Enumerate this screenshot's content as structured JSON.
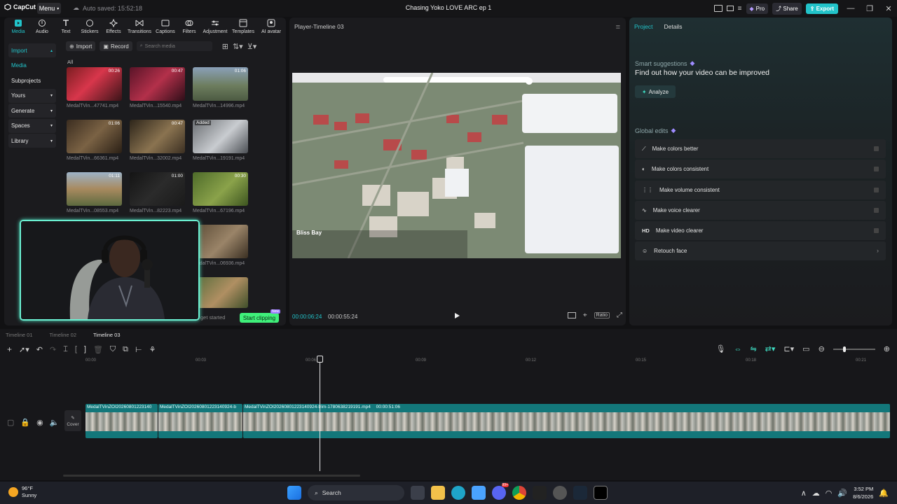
{
  "titlebar": {
    "logo": "CapCut",
    "menu_label": "Menu",
    "autosave": "Auto saved: 15:52:18",
    "project_title": "Chasing Yoko LOVE ARC ep 1",
    "pro_label": "Pro",
    "share_label": "Share",
    "export_label": "Export"
  },
  "toolbar": {
    "tools": [
      {
        "label": "Media",
        "icon": "media-icon"
      },
      {
        "label": "Audio",
        "icon": "audio-icon"
      },
      {
        "label": "Text",
        "icon": "text-icon"
      },
      {
        "label": "Stickers",
        "icon": "stickers-icon"
      },
      {
        "label": "Effects",
        "icon": "effects-icon"
      },
      {
        "label": "Transitions",
        "icon": "transitions-icon"
      },
      {
        "label": "Captions",
        "icon": "captions-icon"
      },
      {
        "label": "Filters",
        "icon": "filters-icon"
      },
      {
        "label": "Adjustment",
        "icon": "adjustment-icon"
      },
      {
        "label": "Templates",
        "icon": "templates-icon"
      },
      {
        "label": "AI avatar",
        "icon": "ai-avatar-icon"
      }
    ]
  },
  "sidebar": {
    "items": [
      {
        "label": "Import"
      },
      {
        "label": "Media"
      },
      {
        "label": "Subprojects"
      },
      {
        "label": "Yours"
      },
      {
        "label": "Generate"
      },
      {
        "label": "Spaces"
      },
      {
        "label": "Library"
      }
    ]
  },
  "media": {
    "import_label": "Import",
    "record_label": "Record",
    "search_placeholder": "Search media",
    "all_label": "All",
    "thumbs": [
      {
        "name": "MedalTVin...47741.mp4",
        "duration": "00:26"
      },
      {
        "name": "MedalTVin...15540.mp4",
        "duration": "00:47"
      },
      {
        "name": "MedalTVin...14996.mp4",
        "duration": "01:06"
      },
      {
        "name": "MedalTVin...66361.mp4",
        "duration": "01:06"
      },
      {
        "name": "MedalTVin...32002.mp4",
        "duration": "00:47"
      },
      {
        "name": "MedalTVin...19191.mp4",
        "duration": "",
        "badge": "Added"
      },
      {
        "name": "MedalTVin...08553.mp4",
        "duration": "01:11"
      },
      {
        "name": "MedalTVin...82223.mp4",
        "duration": "01:00"
      },
      {
        "name": "MedalTVin...67196.mp4",
        "duration": "00:30"
      },
      {
        "name": "MedalTVin...06936.mp4",
        "duration": ""
      },
      {
        "name": "",
        "duration": ""
      }
    ],
    "get_started": "get started",
    "start_clipping": "Start clipping",
    "new_badge": "New"
  },
  "player": {
    "title": "Player-Timeline 03",
    "current_time": "00:00:06:24",
    "total_time": "00:00:55:24",
    "ratio_label": "Ratio",
    "preview_caption": "Bliss Bay"
  },
  "right_panel": {
    "tabs": [
      "Project",
      "Details"
    ],
    "smart_title": "Smart suggestions",
    "smart_sub": "Find out how your video can be improved",
    "analyze_label": "Analyze",
    "global_edits_title": "Global edits",
    "global_edits": [
      {
        "label": "Make colors better",
        "icon": "wand-icon"
      },
      {
        "label": "Make colors consistent",
        "icon": "palette-icon"
      },
      {
        "label": "Make volume consistent",
        "icon": "volume-bars-icon"
      },
      {
        "label": "Make voice clearer",
        "icon": "voice-icon"
      },
      {
        "label": "Make video clearer",
        "icon": "hd-icon",
        "icon_text": "HD"
      },
      {
        "label": "Retouch face",
        "icon": "retouch-icon"
      }
    ]
  },
  "timeline": {
    "tabs": [
      "Timeline 01",
      "Timeline 02",
      "Timeline 03"
    ],
    "ruler": [
      "00:00",
      "00:03",
      "00:06",
      "00:09",
      "00:12",
      "00:15",
      "00:18",
      "00:21"
    ],
    "cover_label": "Cover",
    "clips": [
      {
        "label": "MedalTVinZOI20260801223140",
        "duration": ""
      },
      {
        "label": "MedalTVinZOI20260801223140924-b",
        "duration": ""
      },
      {
        "label": "MedalTVinZOI20260801223140924-trim-1780638219191.mp4",
        "duration": "00:00:51:06"
      }
    ]
  },
  "taskbar": {
    "temp": "96°F",
    "condition": "Sunny",
    "search_label": "Search",
    "time": "3:52 PM",
    "date": "8/6/2026",
    "badge_count": "99+"
  }
}
